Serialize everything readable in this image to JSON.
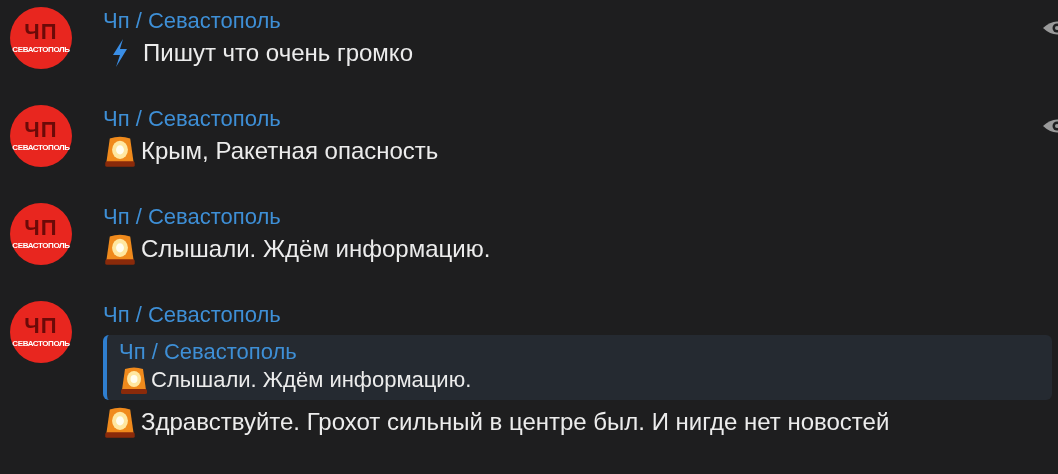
{
  "messages": [
    {
      "avatar": {
        "logo_title": "ЧП",
        "logo_subtitle": "СЕВАСТОПОЛЬ"
      },
      "author": "Чп / Севастополь",
      "kind": "lightning",
      "text": "Пишут что очень громко",
      "views_icon": true
    },
    {
      "avatar": {
        "logo_title": "ЧП",
        "logo_subtitle": "СЕВАСТОПОЛЬ"
      },
      "author": "Чп / Севастополь",
      "kind": "siren",
      "text": "Крым, Ракетная опасность",
      "views_icon": true
    },
    {
      "avatar": {
        "logo_title": "ЧП",
        "logo_subtitle": "СЕВАСТОПОЛЬ"
      },
      "author": "Чп / Севастополь",
      "kind": "siren",
      "text": "Слышали. Ждём информацию.",
      "views_icon": false
    },
    {
      "avatar": {
        "logo_title": "ЧП",
        "logo_subtitle": "СЕВАСТОПОЛЬ"
      },
      "author": "Чп / Севастополь",
      "reply": {
        "author": "Чп / Севастополь",
        "kind": "siren",
        "text": "Слышали. Ждём информацию."
      },
      "kind": "siren",
      "text": "Здравствуйте. Грохот сильный в центре был. И нигде нет новостей",
      "views_icon": false
    }
  ]
}
